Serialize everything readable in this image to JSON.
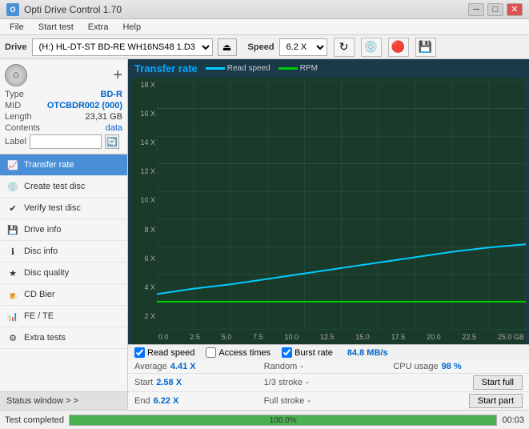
{
  "titlebar": {
    "title": "Opti Drive Control 1.70",
    "icon_label": "O",
    "minimize": "─",
    "maximize": "□",
    "close": "✕"
  },
  "menubar": {
    "items": [
      "File",
      "Start test",
      "Extra",
      "Help"
    ]
  },
  "drivebar": {
    "drive_label": "Drive",
    "drive_value": "(H:) HL-DT-ST BD-RE  WH16NS48 1.D3",
    "speed_label": "Speed",
    "speed_value": "6.2 X"
  },
  "disc_panel": {
    "type_label": "Type",
    "type_value": "BD-R",
    "mid_label": "MID",
    "mid_value": "OTCBDR002 (000)",
    "length_label": "Length",
    "length_value": "23,31 GB",
    "contents_label": "Contents",
    "contents_value": "data",
    "label_label": "Label"
  },
  "nav": {
    "items": [
      {
        "id": "transfer-rate",
        "label": "Transfer rate",
        "active": true
      },
      {
        "id": "create-test-disc",
        "label": "Create test disc",
        "active": false
      },
      {
        "id": "verify-test-disc",
        "label": "Verify test disc",
        "active": false
      },
      {
        "id": "drive-info",
        "label": "Drive info",
        "active": false
      },
      {
        "id": "disc-info",
        "label": "Disc info",
        "active": false
      },
      {
        "id": "disc-quality",
        "label": "Disc quality",
        "active": false
      },
      {
        "id": "cd-bier",
        "label": "CD Bier",
        "active": false
      },
      {
        "id": "fe-te",
        "label": "FE / TE",
        "active": false
      },
      {
        "id": "extra-tests",
        "label": "Extra tests",
        "active": false
      }
    ],
    "status_window": "Status window > >"
  },
  "chart": {
    "title": "Transfer rate",
    "legend": [
      {
        "label": "Read speed",
        "color": "#00ccff"
      },
      {
        "label": "RPM",
        "color": "#00cc00"
      }
    ],
    "y_labels": [
      "18 X",
      "16 X",
      "14 X",
      "12 X",
      "10 X",
      "8 X",
      "6 X",
      "4 X",
      "2 X",
      ""
    ],
    "x_labels": [
      "0.0",
      "2.5",
      "5.0",
      "7.5",
      "10.0",
      "12.5",
      "15.0",
      "17.5",
      "20.0",
      "22.5",
      "25.0 GB"
    ],
    "read_speed_checked": true,
    "access_times_checked": false,
    "burst_rate_checked": true,
    "burst_rate_label": "Burst rate",
    "burst_rate_value": "84.8 MB/s",
    "read_speed_label": "Read speed",
    "access_times_label": "Access times"
  },
  "stats": {
    "row1": {
      "label1": "Average",
      "value1": "4.41 X",
      "label2": "Random",
      "value2": "-",
      "label3": "CPU usage",
      "value3": "98 %"
    },
    "row2": {
      "label1": "Start",
      "value1": "2.58 X",
      "label2": "1/3 stroke",
      "value2": "-",
      "btn": "Start full"
    },
    "row3": {
      "label1": "End",
      "value1": "6.22 X",
      "label2": "Full stroke",
      "value2": "-",
      "btn": "Start part"
    }
  },
  "statusbar": {
    "text": "Test completed",
    "progress": 100,
    "progress_text": "100.0%",
    "time": "00:03"
  }
}
